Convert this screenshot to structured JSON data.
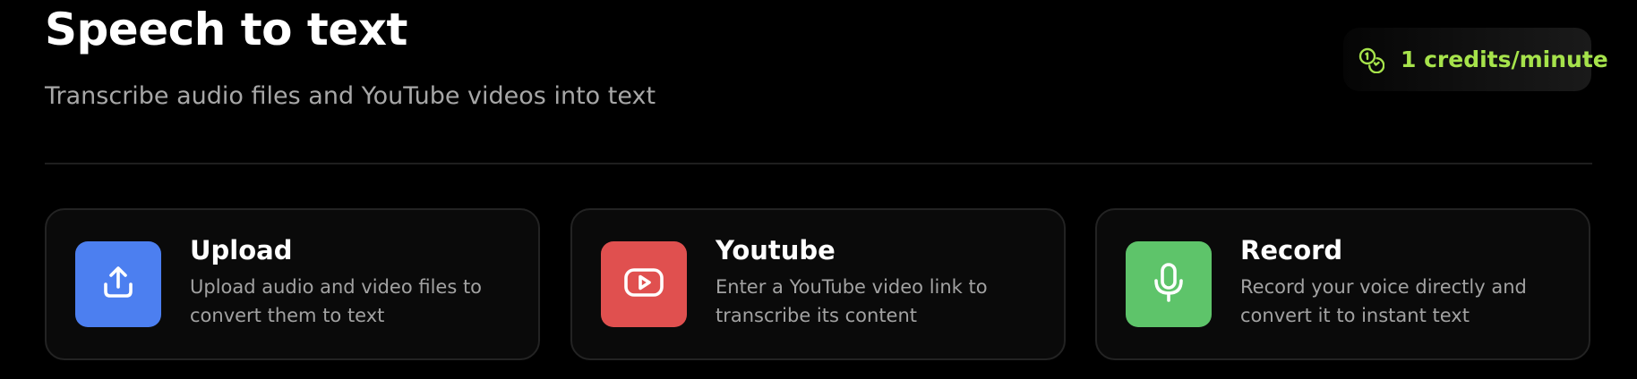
{
  "header": {
    "title": "Speech to text",
    "subtitle": "Transcribe audio files and YouTube videos into text"
  },
  "credits_badge": {
    "icon": "coins-icon",
    "label": "1 credits/minute",
    "color": "#a6e34b"
  },
  "cards": [
    {
      "id": "upload",
      "icon": "upload-icon",
      "color": "#4c7ff0",
      "title": "Upload",
      "description": "Upload audio and video files to convert them to text"
    },
    {
      "id": "youtube",
      "icon": "youtube-play-icon",
      "color": "#e0504f",
      "title": "Youtube",
      "description": "Enter a YouTube video link to transcribe its content"
    },
    {
      "id": "record",
      "icon": "microphone-icon",
      "color": "#5ec46a",
      "title": "Record",
      "description": "Record your voice directly and convert it to instant text"
    }
  ]
}
